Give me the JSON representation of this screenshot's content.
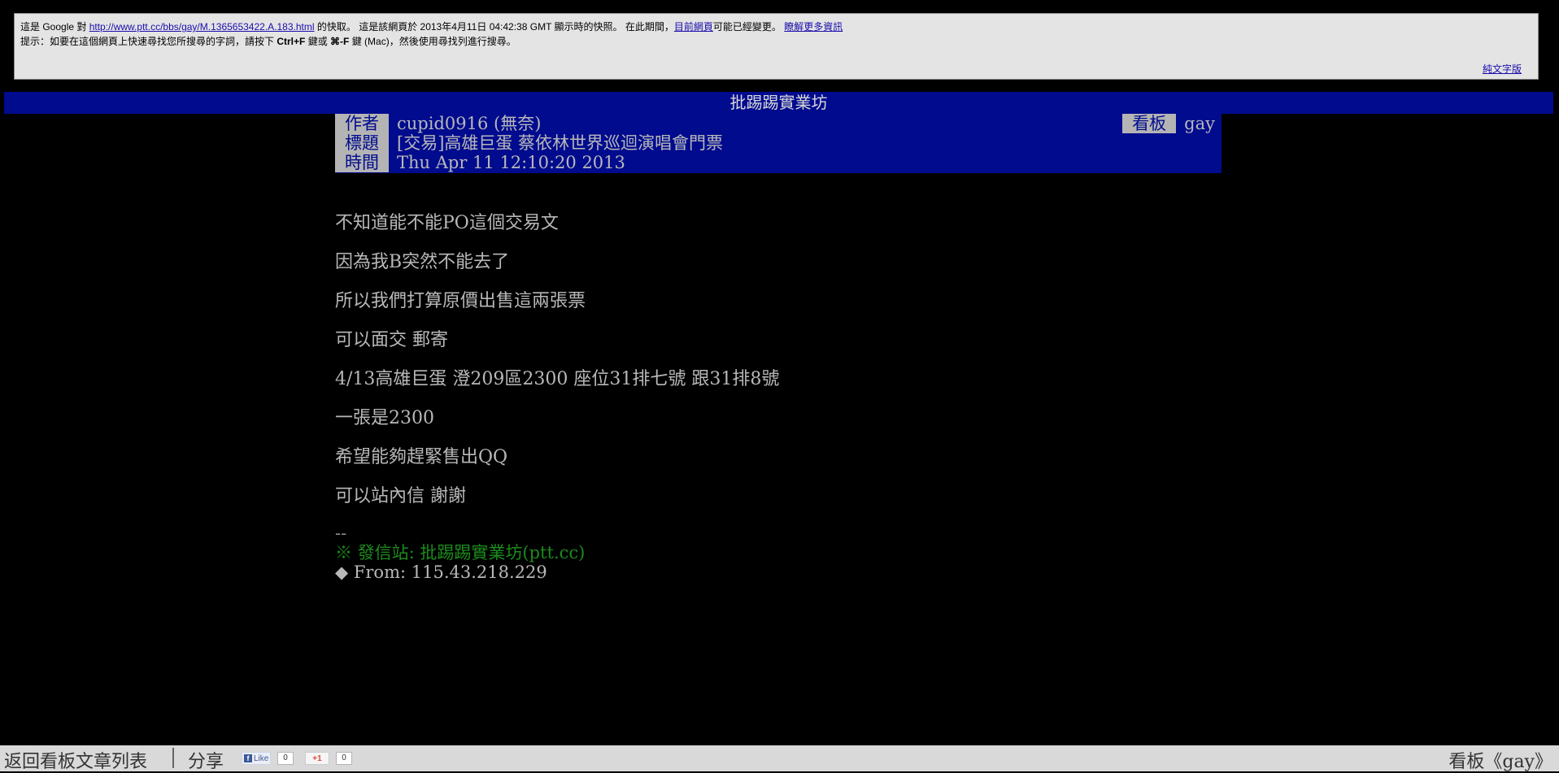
{
  "cache_banner": {
    "prefix": "這是 Google 對 ",
    "cached_url": "http://www.ptt.cc/bbs/gay/M.1365653422.A.183.html",
    "suffix": " 的快取。 這是該網頁於 2013年4月11日 04:42:38 GMT 顯示時的快照。 在此期間，",
    "current_page_link": "目前網頁",
    "may_have_changed": "可能已經變更。 ",
    "learn_more_link": "瞭解更多資訊",
    "tip_prefix": "提示：如要在這個網頁上快速尋找您所搜尋的字詞，請按下 ",
    "tip_shortcut": "Ctrl+F",
    "tip_middle": " 鍵或 ",
    "tip_mac_key": "⌘-F",
    "tip_suffix": " 鍵 (Mac)，然後使用尋找列進行搜尋。",
    "text_only_link": "純文字版"
  },
  "site_title": "批踢踢實業坊",
  "article_meta": {
    "author_tag": "作者",
    "author_value": "cupid0916 (無奈)",
    "title_tag": "標題",
    "title_value": "[交易]高雄巨蛋 蔡依林世界巡迴演唱會門票",
    "time_tag": "時間",
    "time_value": "Thu Apr 11 12:10:20 2013",
    "board_tag": "看板",
    "board_value": "gay"
  },
  "article_body": {
    "paragraphs": [
      "不知道能不能PO這個交易文",
      "因為我B突然不能去了",
      "所以我們打算原價出售這兩張票",
      "可以面交 郵寄",
      "4/13高雄巨蛋 澄209區2300 座位31排七號 跟31排8號",
      "一張是2300",
      "希望能夠趕緊售出QQ",
      "可以站內信 謝謝"
    ]
  },
  "signature": {
    "separator": "--",
    "origin": "※ 發信站: 批踢踢實業坊(ptt.cc)",
    "from": "◆ From: 115.43.218.229"
  },
  "bottom_bar": {
    "back_label": "返回看板文章列表",
    "share_label": "分享",
    "fb_like_label": "Like",
    "fb_count": "0",
    "gplus_label": "+1",
    "gplus_count": "0",
    "board_label": "看板《gay》"
  },
  "colors": {
    "background": "#000000",
    "header_blue": "#000b8e",
    "tag_gray": "#b4b4b4",
    "text_gray": "#b8b8b8",
    "signature_green": "#1c8c1c"
  }
}
